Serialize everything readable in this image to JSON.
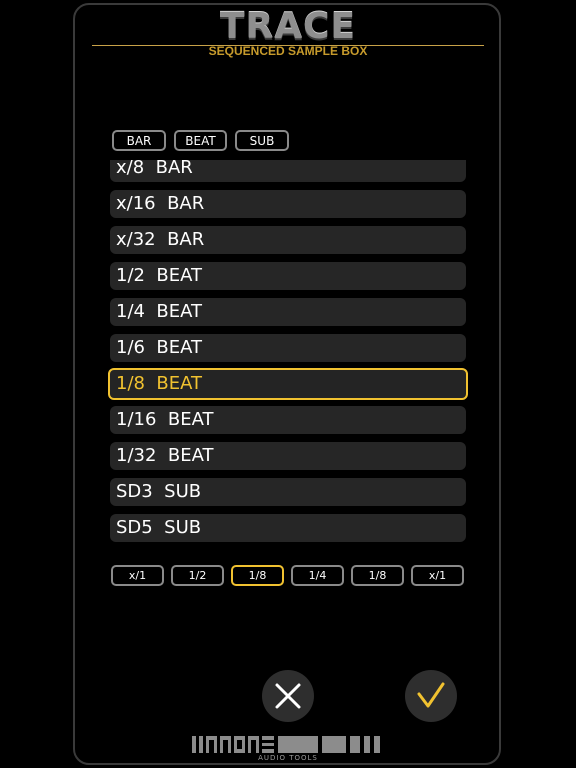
{
  "header": {
    "app_title": "TRACE",
    "app_subtitle": "SEQUENCED SAMPLE BOX"
  },
  "tabs": [
    {
      "label": "BAR"
    },
    {
      "label": "BEAT"
    },
    {
      "label": "SUB"
    }
  ],
  "list": {
    "items": [
      {
        "label": "x/8  BAR",
        "selected": false
      },
      {
        "label": "x/16  BAR",
        "selected": false
      },
      {
        "label": "x/32  BAR",
        "selected": false
      },
      {
        "label": "1/2  BEAT",
        "selected": false
      },
      {
        "label": "1/4  BEAT",
        "selected": false
      },
      {
        "label": "1/6  BEAT",
        "selected": false
      },
      {
        "label": "1/8  BEAT",
        "selected": true
      },
      {
        "label": "1/16  BEAT",
        "selected": false
      },
      {
        "label": "1/32  BEAT",
        "selected": false
      },
      {
        "label": "SD3  SUB",
        "selected": false
      },
      {
        "label": "SD5  SUB",
        "selected": false
      }
    ]
  },
  "segments": [
    {
      "label": "x/1",
      "active": false
    },
    {
      "label": "1/2",
      "active": false
    },
    {
      "label": "1/8",
      "active": true
    },
    {
      "label": "1/4",
      "active": false
    },
    {
      "label": "1/8",
      "active": false
    },
    {
      "label": "x/1",
      "active": false
    }
  ],
  "actions": {
    "cancel_icon": "close-icon",
    "confirm_icon": "checkmark-icon"
  },
  "footer": {
    "brand_subtitle": "AUDIO TOOLS"
  },
  "colors": {
    "accent": "#f1c230",
    "item_bg": "#262626",
    "border": "#8a8a8a",
    "logo_gold": "#c79b2c"
  }
}
